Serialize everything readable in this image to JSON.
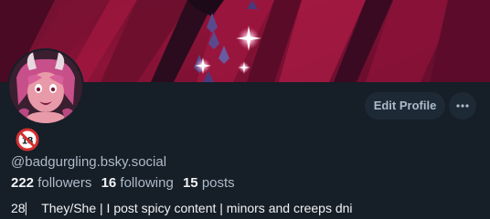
{
  "profile": {
    "handle": "@badgurgling.bsky.social",
    "age_emoji": "🔞",
    "followers_count": "222",
    "followers_label": "followers",
    "following_count": "16",
    "following_label": "following",
    "posts_count": "15",
    "posts_label": "posts",
    "bio": "28⎸ They/She | I post spicy content | minors and creeps dni"
  },
  "actions": {
    "edit_profile_label": "Edit Profile",
    "more_icon": "more-horizontal-icon"
  },
  "colors": {
    "background": "#161e27",
    "button_bg": "#1e2936",
    "muted_text": "#aebbc9",
    "primary_text": "#f1f3f5",
    "banner_primary": "#8a1238",
    "banner_dark": "#2a0c1e",
    "no_under_18_red": "#d32f2f"
  }
}
